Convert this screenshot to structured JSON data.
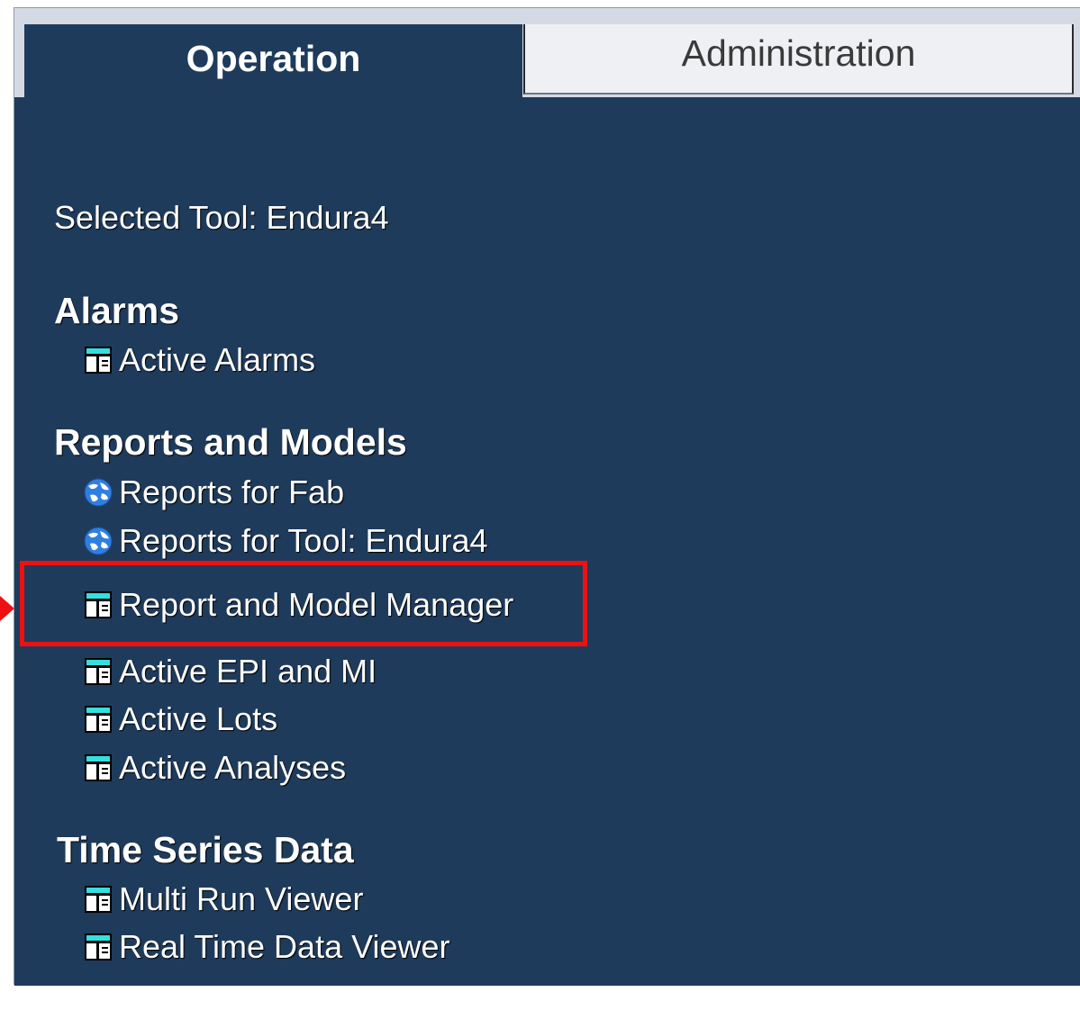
{
  "tabs": {
    "operation": "Operation",
    "administration": "Administration"
  },
  "selected_tool": "Selected Tool: Endura4",
  "sections": {
    "alarms": {
      "heading": "Alarms",
      "items": [
        {
          "label": "Active Alarms",
          "icon": "table-icon"
        }
      ]
    },
    "reports": {
      "heading": "Reports and Models",
      "items": [
        {
          "label": "Reports for Fab",
          "icon": "globe-icon"
        },
        {
          "label": "Reports for Tool: Endura4",
          "icon": "globe-icon"
        },
        {
          "label": "Report and Model Manager",
          "icon": "table-icon"
        },
        {
          "label": "Active EPI and MI",
          "icon": "table-icon"
        },
        {
          "label": "Active Lots",
          "icon": "table-icon"
        },
        {
          "label": "Active Analyses",
          "icon": "table-icon"
        }
      ]
    },
    "time_series": {
      "heading": "Time Series Data",
      "items": [
        {
          "label": "Multi Run Viewer",
          "icon": "table-icon"
        },
        {
          "label": "Real Time Data Viewer",
          "icon": "table-icon"
        }
      ]
    }
  },
  "colors": {
    "panel_bg": "#1f3b5b",
    "highlight": "#ee1111",
    "icon_header": "#33e0e0"
  }
}
